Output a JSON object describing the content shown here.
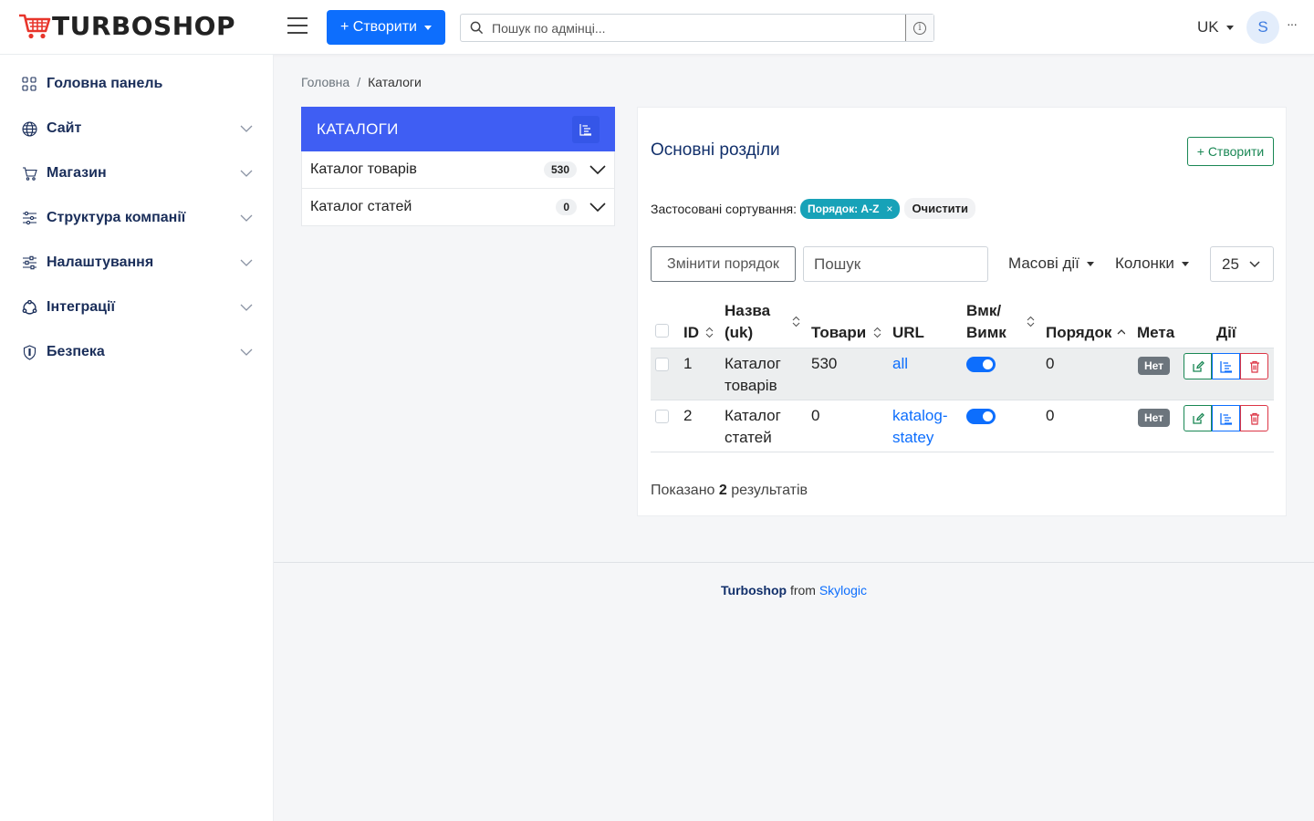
{
  "brand": {
    "name": "TURBOSHOP"
  },
  "topbar": {
    "create_label": "+ Створити",
    "search_placeholder": "Пошук по адмінці...",
    "lang": "UK",
    "avatar_letter": "S",
    "more": "···"
  },
  "sidebar": {
    "items": [
      {
        "label": "Головна панель",
        "icon": "dashboard-icon",
        "has_children": false
      },
      {
        "label": "Сайт",
        "icon": "globe-icon",
        "has_children": true
      },
      {
        "label": "Магазин",
        "icon": "cart-icon",
        "has_children": true
      },
      {
        "label": "Структура компанії",
        "icon": "structure-icon",
        "has_children": true
      },
      {
        "label": "Налаштування",
        "icon": "sliders-icon",
        "has_children": true
      },
      {
        "label": "Інтеграції",
        "icon": "integrations-icon",
        "has_children": true
      },
      {
        "label": "Безпека",
        "icon": "shield-icon",
        "has_children": true
      }
    ]
  },
  "breadcrumb": {
    "home": "Головна",
    "separator": "/",
    "current": "Каталоги"
  },
  "catalogs": {
    "title": "КАТАЛОГИ",
    "items": [
      {
        "label": "Каталог товарів",
        "count": "530"
      },
      {
        "label": "Каталог статей",
        "count": "0"
      }
    ]
  },
  "main": {
    "title": "Основні розділи",
    "create_label": "+ Створити",
    "sort_label": "Застосовані сортування:",
    "sort_chip": "Порядок: A-Z",
    "sort_chip_close": "×",
    "clear_label": "Очистити",
    "reorder_label": "Змінити порядок",
    "search_placeholder": "Пошук",
    "mass_label": "Масові дії",
    "columns_label": "Колонки",
    "per_page": "25",
    "headers": {
      "id": "ID",
      "name_1": "Назва",
      "name_2": "(uk)",
      "products": "Товари",
      "url": "URL",
      "toggle_1": "Вмк/",
      "toggle_2": "Вимк",
      "order": "Порядок",
      "meta": "Мета",
      "actions": "Дії"
    },
    "rows": [
      {
        "id": "1",
        "name_1": "Каталог",
        "name_2": "товарів",
        "products": "530",
        "url_1": "all",
        "url_2": "",
        "enabled": true,
        "order": "0",
        "meta": "Нет"
      },
      {
        "id": "2",
        "name_1": "Каталог",
        "name_2": "статей",
        "products": "0",
        "url_1": "katalog-",
        "url_2": "statey",
        "enabled": true,
        "order": "0",
        "meta": "Нет"
      }
    ],
    "results_prefix": "Показано",
    "results_count": "2",
    "results_suffix": "результатів"
  },
  "footer": {
    "brand": "Turboshop",
    "from": "from",
    "company": "Skylogic"
  },
  "colors": {
    "primary": "#0d6efd",
    "catalog_header": "#3f5ef3",
    "success": "#198754",
    "danger": "#dc3545",
    "info": "#17a2b8"
  }
}
